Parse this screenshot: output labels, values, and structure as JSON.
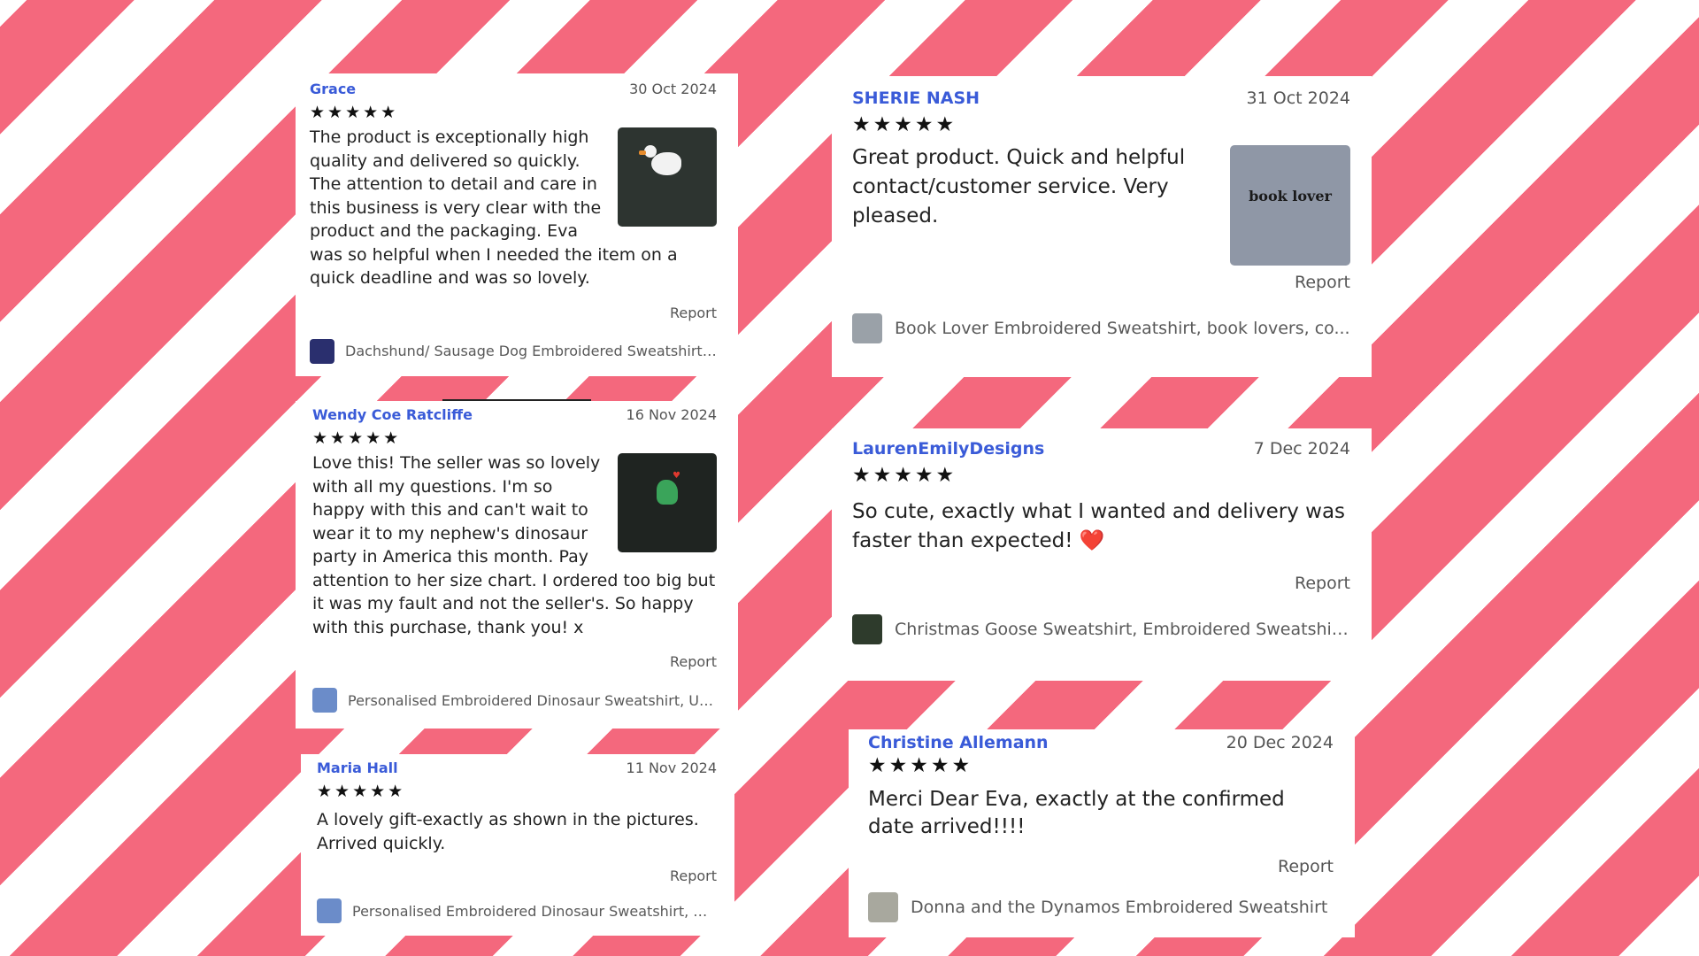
{
  "reviews": [
    {
      "name": "Grace",
      "date": "30 Oct 2024",
      "stars": "★★★★★",
      "text": "The product is exceptionally high quality and delivered so quickly. The attention to detail and care in this business is very clear with the product and the packaging. Eva was so helpful when I needed the item on a quick deadline and was so lovely.",
      "report": "Report",
      "product": "Dachshund/ Sausage Dog Embroidered Sweatshirt/ J..."
    },
    {
      "name": "Wendy Coe Ratcliffe",
      "date": "16 Nov 2024",
      "stars": "★★★★★",
      "text": "Love this! The seller was so lovely with all my questions. I'm so happy with this and can't wait to wear it to my nephew's dinosaur party in America this month. Pay attention to her size chart. I ordered too big but it was my fault and not the seller's. So happy with this purchase, thank you! x",
      "report": "Report",
      "product": "Personalised Embroidered Dinosaur Sweatshirt, Unis..."
    },
    {
      "name": "Maria Hall",
      "date": "11 Nov 2024",
      "stars": "★★★★★",
      "text": "A lovely gift-exactly as shown in the pictures. Arrived quickly.",
      "report": "Report",
      "product": "Personalised Embroidered Dinosaur Sweatshirt, Unis..."
    },
    {
      "name": "SHERIE NASH",
      "date": "31 Oct 2024",
      "stars": "★★★★★",
      "text": "Great product. Quick and helpful contact/customer service. Very pleased.",
      "report": "Report",
      "product": "Book Lover Embroidered Sweatshirt, book lovers, co...",
      "thumb_text": "book lover"
    },
    {
      "name": "LaurenEmilyDesigns",
      "date": "7 Dec 2024",
      "stars": "★★★★★",
      "text": "So cute, exactly what I wanted and delivery was faster than expected! ❤️",
      "report": "Report",
      "product": "Christmas Goose Sweatshirt, Embroidered Sweatshir..."
    },
    {
      "name": "Christine Allemann",
      "date": "20 Dec 2024",
      "stars": "★★★★★",
      "text": "Merci Dear Eva, exactly at the confirmed date arrived!!!!",
      "report": "Report",
      "product": "Donna and the Dynamos Embroidered Sweatshirt"
    }
  ],
  "colors": {
    "stripe": "#f4687d",
    "reviewer_name": "#3a5bd8"
  },
  "icons": {
    "rating": "star-icon"
  }
}
